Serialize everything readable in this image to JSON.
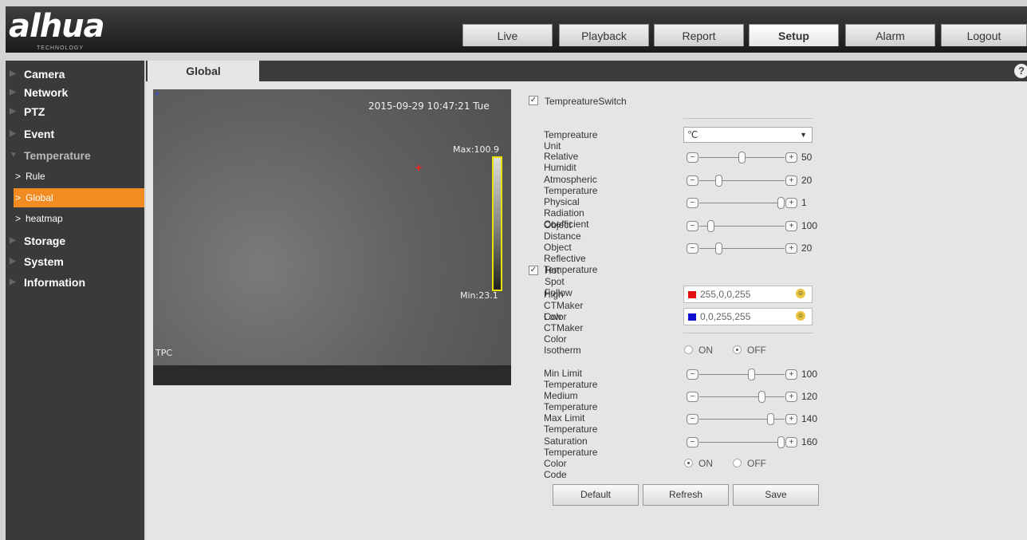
{
  "header": {
    "logo_text": "alhua",
    "logo_sub": "TECHNOLOGY",
    "tabs": [
      {
        "label": "Live"
      },
      {
        "label": "Playback"
      },
      {
        "label": "Report"
      },
      {
        "label": "Setup"
      },
      {
        "label": "Alarm"
      },
      {
        "label": "Logout"
      }
    ],
    "active_tab": "Setup"
  },
  "sidebar": {
    "items": [
      {
        "label": "Camera"
      },
      {
        "label": "Network"
      },
      {
        "label": "PTZ"
      },
      {
        "label": "Event"
      },
      {
        "label": "Temperature"
      },
      {
        "label": "Storage"
      },
      {
        "label": "System"
      },
      {
        "label": "Information"
      }
    ],
    "temperature_children": [
      {
        "label": "Rule"
      },
      {
        "label": "Global"
      },
      {
        "label": "heatmap"
      }
    ],
    "active_child": "Global",
    "accent_color": "#f28b22"
  },
  "panel": {
    "tab_label": "Global",
    "help_glyph": "?"
  },
  "video": {
    "timestamp": "2015-09-29 10:47:21 Tue",
    "max_label": "Max:100.9",
    "min_label": "Min:23.1",
    "channel_label": "TPC"
  },
  "form": {
    "temperature_switch": {
      "label": "TempreatureSwitch",
      "checked": true
    },
    "temperature_unit": {
      "label": "Tempreature Unit",
      "value": "℃"
    },
    "relative_humidity": {
      "label": "Relative Humidit",
      "value": "50",
      "level": 0.5
    },
    "atmospheric_temperature": {
      "label": "Atmospheric Temperature",
      "value": "20",
      "level": 0.2
    },
    "radiation_coefficient": {
      "label": "Physical Radiation Coefficient",
      "value": "1",
      "level": 1.0
    },
    "object_distance": {
      "label": "Object Distance",
      "value": "100",
      "level": 0.1
    },
    "reflective_temperature": {
      "label": "Object Reflective Temperature",
      "value": "20",
      "level": 0.2
    },
    "hot_spot_follow": {
      "label": "Hot Spot Follow",
      "checked": true
    },
    "high_color": {
      "label": "High CTMaker Color",
      "value": "255,0,0,255",
      "swatch": "#e01010"
    },
    "low_color": {
      "label": "Low CTMaker Color",
      "value": "0,0,255,255",
      "swatch": "#1010d0"
    },
    "isotherm": {
      "label": "Isotherm",
      "on_label": "ON",
      "off_label": "OFF",
      "selected": "OFF"
    },
    "min_limit": {
      "label": "Min Limit Temperature",
      "value": "100",
      "level": 0.62
    },
    "medium": {
      "label": "Medium Temperature",
      "value": "120",
      "level": 0.75
    },
    "max_limit": {
      "label": "Max Limit Temperature",
      "value": "140",
      "level": 0.87
    },
    "saturation": {
      "label": "Saturation Temperature",
      "value": "160",
      "level": 1.0
    },
    "color_code": {
      "label": "Color Code",
      "on_label": "ON",
      "off_label": "OFF",
      "selected": "ON"
    }
  },
  "buttons": {
    "default_label": "Default",
    "refresh_label": "Refresh",
    "save_label": "Save"
  }
}
